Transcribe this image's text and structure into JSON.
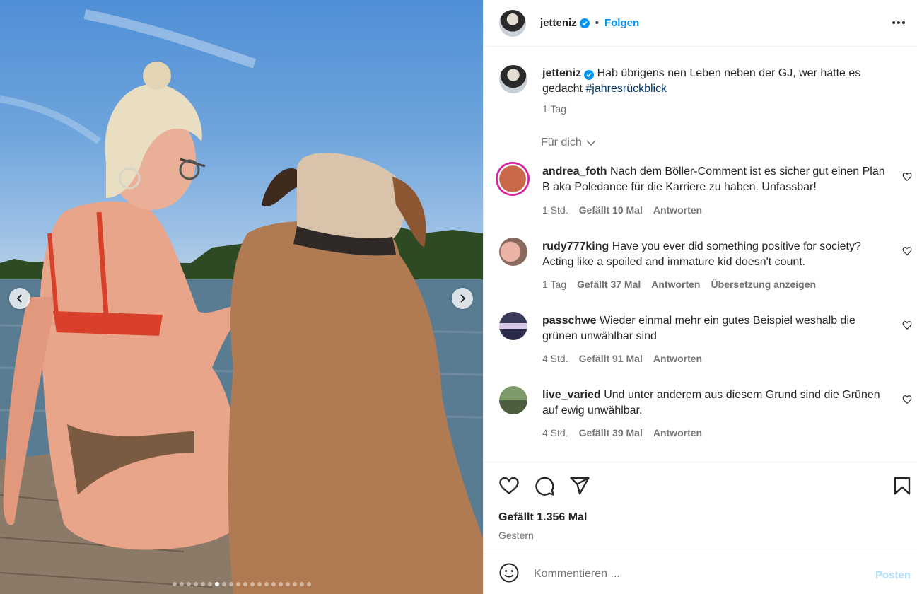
{
  "post": {
    "username": "jetteniz",
    "follow_label": "Folgen",
    "separator": "•"
  },
  "caption": {
    "username": "jetteniz",
    "text": "Hab übrigens nen Leben neben der GJ, wer hätte es gedacht ",
    "hashtag": "#jahresrückblick",
    "time": "1 Tag"
  },
  "sort_label": "Für dich",
  "comments": [
    {
      "username": "andrea_foth",
      "text": "Nach dem Böller-Comment ist es sicher gut einen Plan B aka Poledance für die Karriere zu haben. Unfassbar!",
      "time": "1 Std.",
      "likes": "Gefällt 10 Mal",
      "reply": "Antworten"
    },
    {
      "username": "rudy777king",
      "text": "Have you ever did something positive for society? Acting like a spoiled and immature kid doesn't count.",
      "time": "1 Tag",
      "likes": "Gefällt 37 Mal",
      "reply": "Antworten",
      "translate": "Übersetzung anzeigen"
    },
    {
      "username": "passchwe",
      "text": "Wieder einmal mehr ein gutes Beispiel weshalb die grünen unwählbar sind",
      "time": "4 Std.",
      "likes": "Gefällt 91 Mal",
      "reply": "Antworten"
    },
    {
      "username": "live_varied",
      "text": "Und unter anderem aus diesem Grund sind die Grünen auf ewig unwählbar.",
      "time": "4 Std.",
      "likes": "Gefällt 39 Mal",
      "reply": "Antworten"
    }
  ],
  "engagement": {
    "likes": "Gefällt 1.356 Mal",
    "date": "Gestern"
  },
  "composer": {
    "placeholder": "Kommentieren ...",
    "post_label": "Posten"
  },
  "carousel": {
    "slide_count": 20,
    "active_index": 6
  },
  "colors": {
    "accent": "#0095f6",
    "hashtag": "#00376b",
    "secondary_text": "#737373"
  }
}
